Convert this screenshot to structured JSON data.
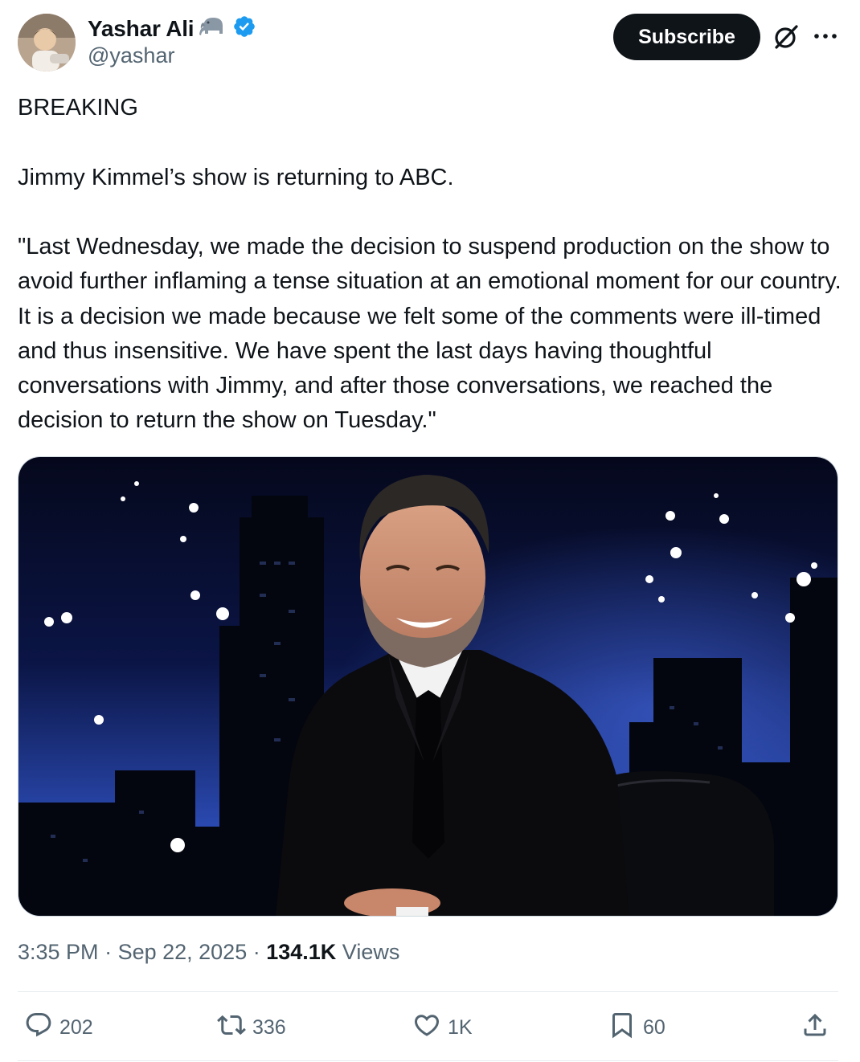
{
  "author": {
    "display_name": "Yashar Ali",
    "handle": "@yashar",
    "verified": true,
    "emoji_badge": "elephant-icon"
  },
  "header": {
    "subscribe_label": "Subscribe",
    "icons": [
      "grok-icon",
      "more-icon"
    ]
  },
  "tweet": {
    "line1": "BREAKING",
    "line2": "Jimmy Kimmel’s show is returning to ABC.",
    "line3": "\"Last Wednesday, we made the decision to suspend production on the show to avoid further inflaming a tense situation at an emotional moment for our country.  It is a decision we made because we felt some of the comments were ill-timed and thus insensitive.  We have spent the last days having thoughtful conversations with Jimmy, and after those conversations, we reached the decision to return the show on Tuesday.\""
  },
  "meta": {
    "time": "3:35 PM",
    "sep1": " · ",
    "date": "Sep 22, 2025",
    "sep2": " · ",
    "views_count": "134.1K",
    "views_label": " Views"
  },
  "actions": {
    "replies": "202",
    "reposts": "336",
    "likes": "1K",
    "bookmarks": "60"
  },
  "colors": {
    "text": "#0f1419",
    "secondary": "#536471",
    "verified": "#1d9bf0",
    "subscribe_bg": "#0f1419"
  }
}
